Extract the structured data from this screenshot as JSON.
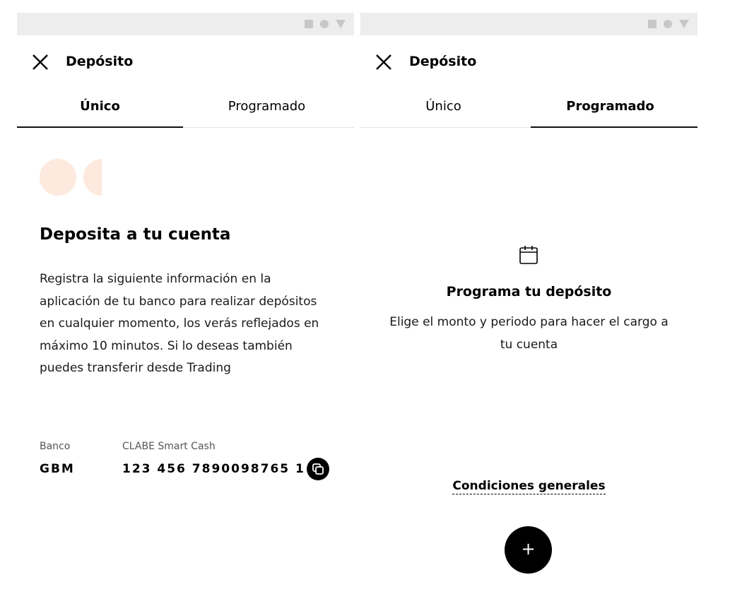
{
  "screens": [
    {
      "title": "Depósito",
      "tabs": [
        {
          "label": "Único",
          "active": true
        },
        {
          "label": "Programado",
          "active": false
        }
      ],
      "heading": "Deposita a tu cuenta",
      "description": "Registra la siguiente información en la aplicación de tu banco para realizar depósitos en cualquier momento, los verás reflejados en máximo 10 minutos. Si lo deseas también puedes transferir desde Trading",
      "bank": {
        "label": "Banco",
        "value": "GBM"
      },
      "clabe": {
        "label": "CLABE Smart Cash",
        "value": "123 456 7890098765 1"
      },
      "icons": {
        "close": "close-icon",
        "copy": "copy-icon"
      },
      "deco_color": "#fde9dd"
    },
    {
      "title": "Depósito",
      "tabs": [
        {
          "label": "Único",
          "active": false
        },
        {
          "label": "Programado",
          "active": true
        }
      ],
      "heading": "Programa tu depósito",
      "description": "Elige el monto y periodo para hacer el cargo a tu cuenta",
      "link": "Condiciones generales",
      "fab_symbol": "+",
      "icons": {
        "close": "close-icon",
        "calendar": "calendar-icon",
        "add": "plus-icon"
      }
    }
  ],
  "colors": {
    "statusbar": "#ededed",
    "accent": "#000000",
    "tab_inactive_line": "#e3e3e3"
  }
}
